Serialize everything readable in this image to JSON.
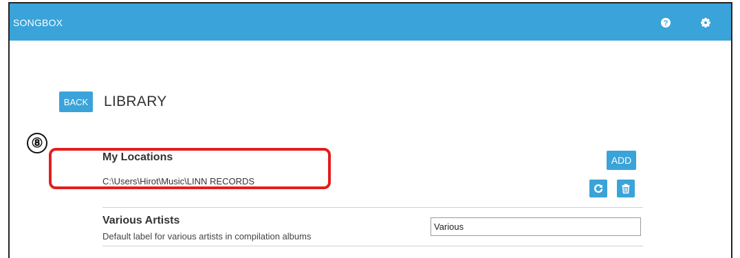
{
  "app": {
    "title": "SONGBOX"
  },
  "topbar": {
    "help_icon": "help-circle-icon",
    "settings_icon": "gear-icon"
  },
  "nav": {
    "back_label": "BACK",
    "page_title": "LIBRARY"
  },
  "annotation": {
    "callout_number": "⑧",
    "highlight_color": "#e51c1c"
  },
  "locations": {
    "title": "My Locations",
    "paths": [
      "C:\\Users\\Hirot\\Music\\LINN RECORDS"
    ],
    "add_label": "ADD",
    "refresh_icon": "refresh-icon",
    "delete_icon": "trash-icon"
  },
  "various_artists": {
    "title": "Various Artists",
    "description": "Default label for various artists in compilation albums",
    "value": "Various"
  },
  "colors": {
    "accent": "#3aa3d9",
    "text": "#333333",
    "callout_border": "#e51c1c"
  }
}
